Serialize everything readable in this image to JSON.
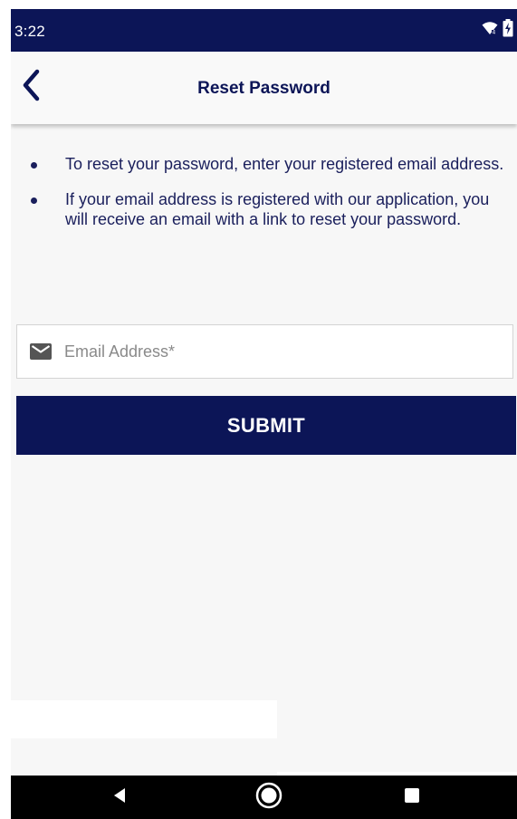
{
  "status_bar": {
    "time": "3:22",
    "icons": [
      "wifi-icon",
      "battery-charging-icon"
    ]
  },
  "app_bar": {
    "back_icon": "chevron-left-icon",
    "title": "Reset Password"
  },
  "instructions": [
    "To reset your password, enter your registered email address.",
    "If your email address is registered with our application, you will receive an email with a link to reset your password."
  ],
  "email_field": {
    "icon": "mail-icon",
    "value": "",
    "placeholder": "Email Address*"
  },
  "submit_button": {
    "label": "SUBMIT"
  },
  "nav_bar": {
    "icons": [
      "back-triangle-icon",
      "home-circle-icon",
      "recents-square-icon"
    ]
  },
  "colors": {
    "primary": "#0c1557",
    "background": "#f7f7f7",
    "text": "#1a1f5c",
    "placeholder": "#8a8a8a"
  }
}
